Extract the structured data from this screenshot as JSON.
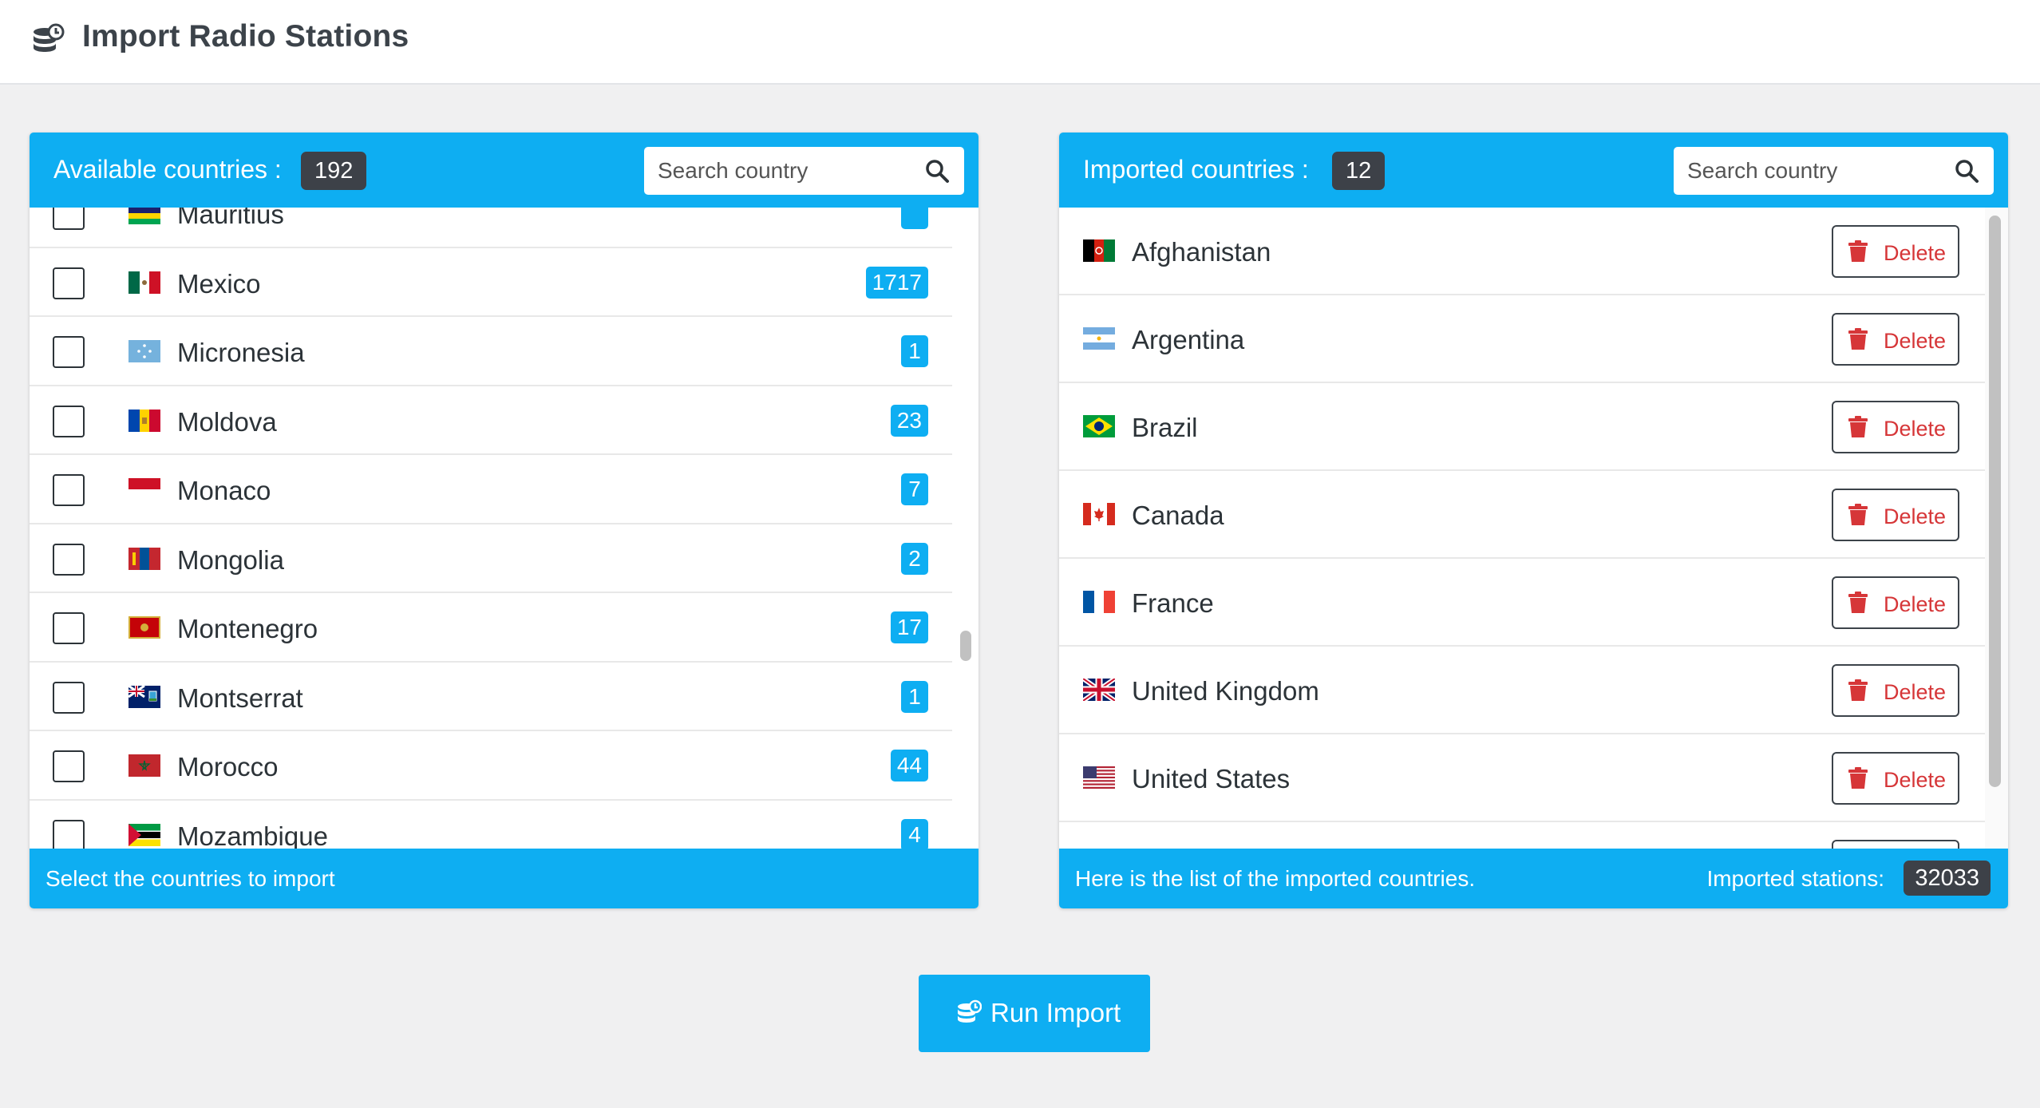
{
  "page": {
    "title": "Import Radio Stations",
    "title_icon": "database-sync-icon"
  },
  "available": {
    "title": "Available countries :",
    "count": "192",
    "search_placeholder": "Search country",
    "footer_text": "Select the countries to import",
    "items": [
      {
        "name": "Mauritius",
        "count": "",
        "flag": "mu"
      },
      {
        "name": "Mexico",
        "count": "1717",
        "flag": "mx"
      },
      {
        "name": "Micronesia",
        "count": "1",
        "flag": "fm"
      },
      {
        "name": "Moldova",
        "count": "23",
        "flag": "md"
      },
      {
        "name": "Monaco",
        "count": "7",
        "flag": "mc"
      },
      {
        "name": "Mongolia",
        "count": "2",
        "flag": "mn"
      },
      {
        "name": "Montenegro",
        "count": "17",
        "flag": "me"
      },
      {
        "name": "Montserrat",
        "count": "1",
        "flag": "ms"
      },
      {
        "name": "Morocco",
        "count": "44",
        "flag": "ma"
      },
      {
        "name": "Mozambique",
        "count": "4",
        "flag": "mz"
      }
    ]
  },
  "imported": {
    "title": "Imported countries :",
    "count": "12",
    "search_placeholder": "Search country",
    "footer_text": "Here is the list of the imported countries.",
    "stations_label": "Imported stations:",
    "stations_count": "32033",
    "delete_label": "Delete",
    "items": [
      {
        "name": "Afghanistan",
        "flag": "af"
      },
      {
        "name": "Argentina",
        "flag": "ar"
      },
      {
        "name": "Brazil",
        "flag": "br"
      },
      {
        "name": "Canada",
        "flag": "ca"
      },
      {
        "name": "France",
        "flag": "fr"
      },
      {
        "name": "United Kingdom",
        "flag": "gb"
      },
      {
        "name": "United States",
        "flag": "us"
      },
      {
        "name": "",
        "flag": ""
      }
    ]
  },
  "actions": {
    "run_import_label": "Run Import"
  },
  "colors": {
    "accent": "#0eaef2",
    "badge_dark": "#3d4148",
    "danger": "#d63638",
    "background": "#f0f0f1"
  }
}
